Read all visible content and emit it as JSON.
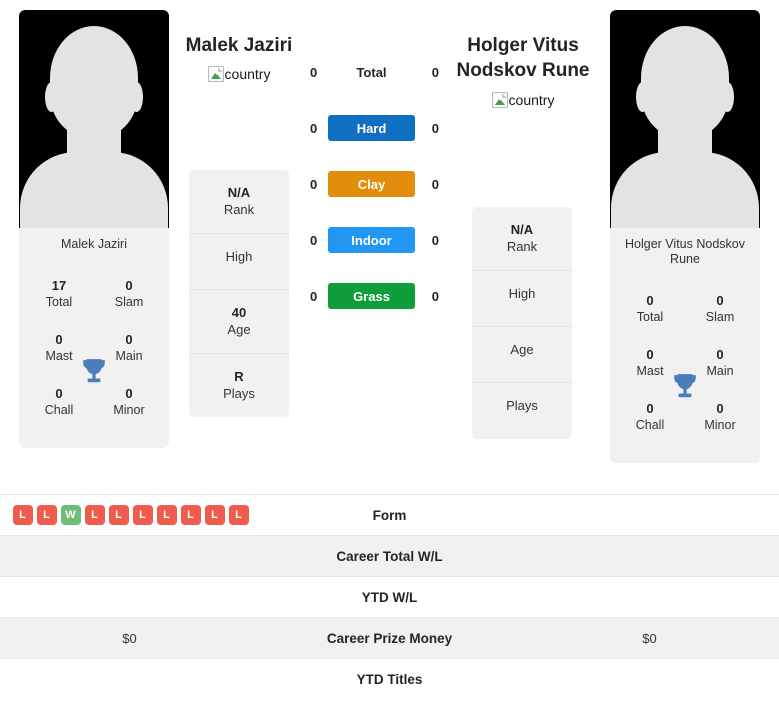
{
  "players": {
    "left": {
      "name": "Malek Jaziri",
      "photo_caption": "Malek Jaziri",
      "country_alt": "country",
      "titles": [
        {
          "value": "17",
          "label": "Total"
        },
        {
          "value": "0",
          "label": "Slam"
        },
        {
          "value": "0",
          "label": "Mast"
        },
        {
          "value": "0",
          "label": "Main"
        },
        {
          "value": "0",
          "label": "Chall"
        },
        {
          "value": "0",
          "label": "Minor"
        }
      ],
      "info": [
        {
          "value": "N/A",
          "label": "Rank"
        },
        {
          "value": "",
          "label": "High"
        },
        {
          "value": "40",
          "label": "Age"
        },
        {
          "value": "R",
          "label": "Plays"
        }
      ]
    },
    "right": {
      "name": "Holger Vitus Nodskov Rune",
      "photo_caption": "Holger Vitus Nodskov Rune",
      "country_alt": "country",
      "titles": [
        {
          "value": "0",
          "label": "Total"
        },
        {
          "value": "0",
          "label": "Slam"
        },
        {
          "value": "0",
          "label": "Mast"
        },
        {
          "value": "0",
          "label": "Main"
        },
        {
          "value": "0",
          "label": "Chall"
        },
        {
          "value": "0",
          "label": "Minor"
        }
      ],
      "info": [
        {
          "value": "N/A",
          "label": "Rank"
        },
        {
          "value": "",
          "label": "High"
        },
        {
          "value": "",
          "label": "Age"
        },
        {
          "value": "",
          "label": "Plays"
        }
      ]
    }
  },
  "surfaces": [
    {
      "label": "Total",
      "left": "0",
      "right": "0",
      "color": "transparent"
    },
    {
      "label": "Hard",
      "left": "0",
      "right": "0",
      "color": "#0f6fc0"
    },
    {
      "label": "Clay",
      "left": "0",
      "right": "0",
      "color": "#e08e0b"
    },
    {
      "label": "Indoor",
      "left": "0",
      "right": "0",
      "color": "#2196f3"
    },
    {
      "label": "Grass",
      "left": "0",
      "right": "0",
      "color": "#0f9d3a"
    }
  ],
  "comparison_rows": [
    {
      "label": "Form",
      "left": "",
      "right": ""
    },
    {
      "label": "Career Total W/L",
      "left": "",
      "right": ""
    },
    {
      "label": "YTD W/L",
      "left": "",
      "right": ""
    },
    {
      "label": "Career Prize Money",
      "left": "$0",
      "right": "$0"
    },
    {
      "label": "YTD Titles",
      "left": "",
      "right": ""
    }
  ],
  "form": {
    "left": [
      "L",
      "L",
      "W",
      "L",
      "L",
      "L",
      "L",
      "L",
      "L",
      "L"
    ],
    "right": []
  },
  "colors": {
    "win": "#70bd7a",
    "loss": "#ef5b4c",
    "trophy": "#4a7ebb",
    "card_bg": "#f1f1f1",
    "row_alt": "#f1f1f1"
  },
  "icons": {
    "trophy": "trophy-icon",
    "broken_image": "broken-image-icon",
    "avatar": "avatar-silhouette-icon"
  }
}
